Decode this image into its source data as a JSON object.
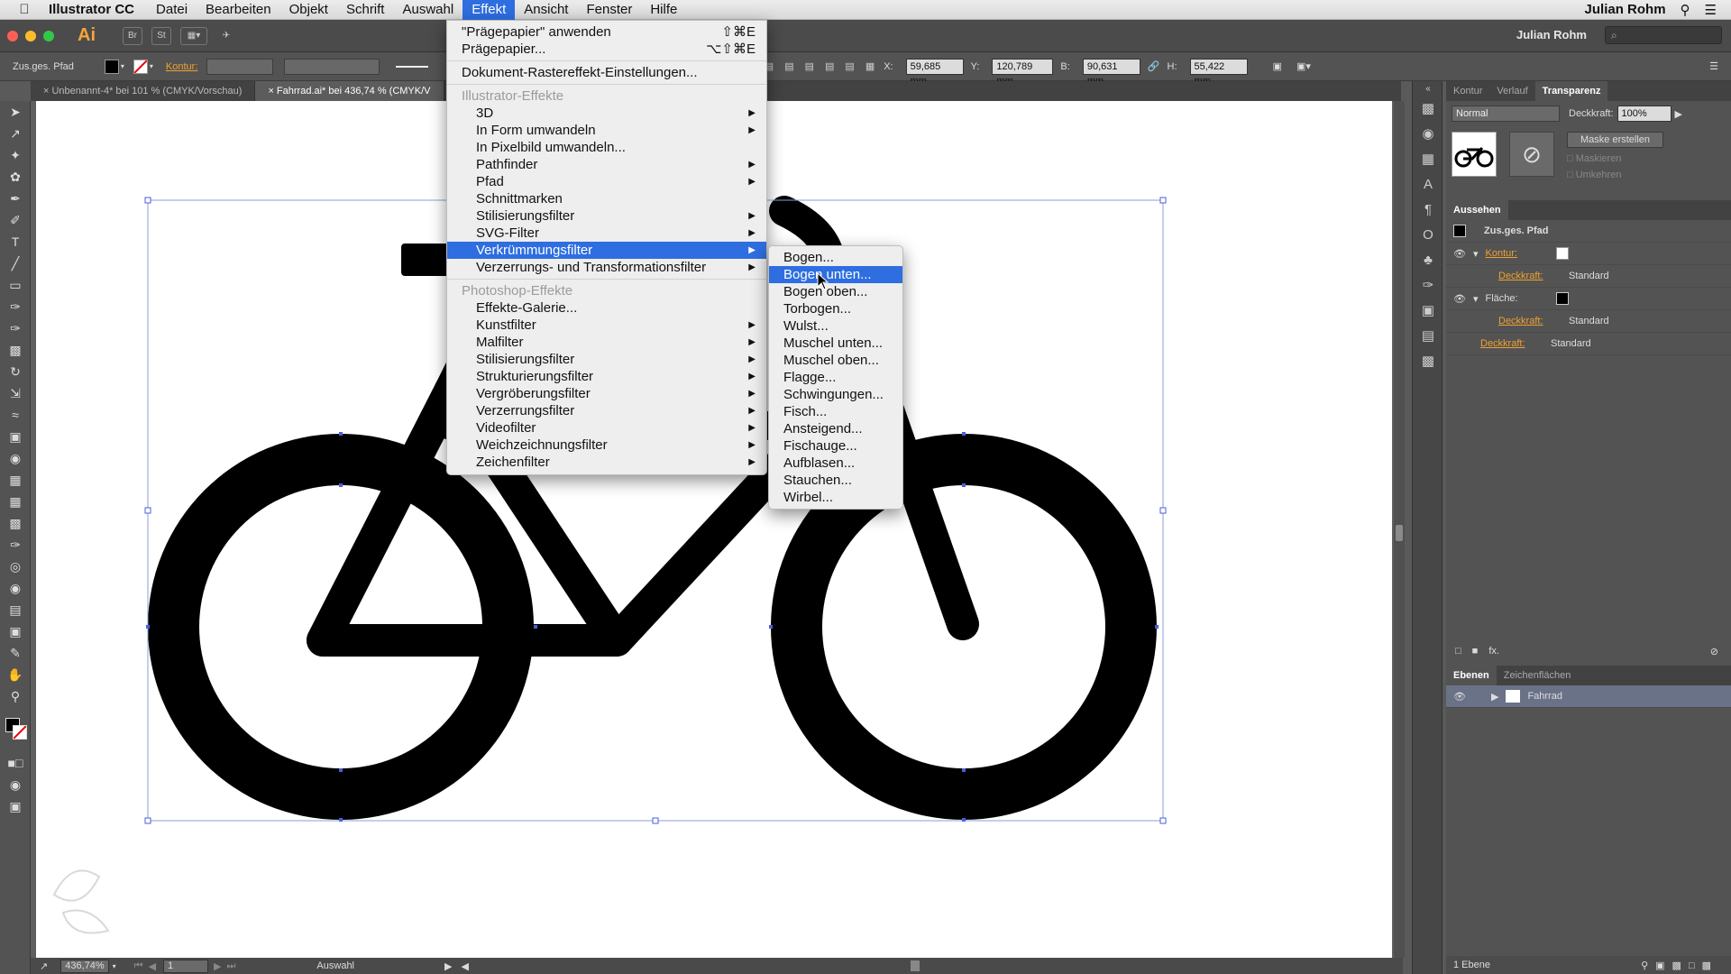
{
  "menubar": {
    "app_name": "Illustrator CC",
    "items": [
      "Datei",
      "Bearbeiten",
      "Objekt",
      "Schrift",
      "Auswahl",
      "Effekt",
      "Ansicht",
      "Fenster",
      "Hilfe"
    ],
    "active": "Effekt",
    "user": "Julian Rohm"
  },
  "appbar": {
    "logo": "Ai",
    "br": "Br",
    "st": "St",
    "workspace": "Julian Rohm",
    "search_placeholder": "⌕"
  },
  "control": {
    "object_type": "Zus.ges. Pfad",
    "kontur_label": "Kontur:",
    "x_label": "X:",
    "x_value": "59,685 mm",
    "y_label": "Y:",
    "y_value": "120,789 mm",
    "b_label": "B:",
    "b_value": "90,631 mm",
    "h_label": "H:",
    "h_value": "55,422 mm"
  },
  "tabs": [
    {
      "label": "Unbenannt-4* bei 101 % (CMYK/Vorschau)"
    },
    {
      "label": "Fahrrad.ai* bei 436,74 % (CMYK/V"
    }
  ],
  "effekt_menu": {
    "top": [
      {
        "label": "\"Prägepapier\" anwenden",
        "shortcut": "⇧⌘E"
      },
      {
        "label": "Prägepapier...",
        "shortcut": "⌥⇧⌘E"
      }
    ],
    "raster_settings": "Dokument-Rastereffekt-Einstellungen...",
    "illustrator_header": "Illustrator-Effekte",
    "illustrator_items": [
      "3D",
      "In Form umwandeln",
      "In Pixelbild umwandeln...",
      "Pathfinder",
      "Pfad",
      "Schnittmarken",
      "Stilisierungsfilter",
      "SVG-Filter",
      "Verkrümmungsfilter",
      "Verzerrungs- und Transformationsfilter"
    ],
    "photoshop_header": "Photoshop-Effekte",
    "photoshop_items": [
      "Effekte-Galerie...",
      "Kunstfilter",
      "Malfilter",
      "Stilisierungsfilter",
      "Strukturierungsfilter",
      "Vergröberungsfilter",
      "Verzerrungsfilter",
      "Videofilter",
      "Weichzeichnungsfilter",
      "Zeichenfilter"
    ]
  },
  "warp_menu": {
    "items": [
      "Bogen...",
      "Bogen unten...",
      "Bogen oben...",
      "Torbogen...",
      "Wulst...",
      "Muschel unten...",
      "Muschel oben...",
      "Flagge...",
      "Schwingungen...",
      "Fisch...",
      "Ansteigend...",
      "Fischauge...",
      "Aufblasen...",
      "Stauchen...",
      "Wirbel..."
    ],
    "highlighted": "Bogen unten..."
  },
  "transparency_panel": {
    "tabs": [
      "Kontur",
      "Verlauf",
      "Transparenz"
    ],
    "blend_mode": "Normal",
    "opacity_label": "Deckkraft:",
    "opacity_value": "100%",
    "mask_button": "Maske erstellen",
    "clip_label": "Maskieren",
    "invert_label": "Umkehren"
  },
  "appearance_panel": {
    "title": "Aussehen",
    "object": "Zus.ges. Pfad",
    "rows": [
      {
        "label": "Kontur:",
        "value": ""
      },
      {
        "label": "Deckkraft:",
        "value": "Standard"
      },
      {
        "label": "Fläche:",
        "value": ""
      },
      {
        "label": "Deckkraft:",
        "value": "Standard"
      },
      {
        "label": "Deckkraft:",
        "value": "Standard"
      }
    ],
    "fx": "fx."
  },
  "layers_panel": {
    "tabs": [
      "Ebenen",
      "Zeichenflächen"
    ],
    "layer": "Fahrrad",
    "count": "1 Ebene"
  },
  "status": {
    "zoom": "436,74%",
    "page": "1",
    "tool": "Auswahl"
  },
  "colors": {
    "menu_highlight": "#2e6ee0",
    "ai_orange": "#f7a43a",
    "selection": "#4a5fd8"
  }
}
